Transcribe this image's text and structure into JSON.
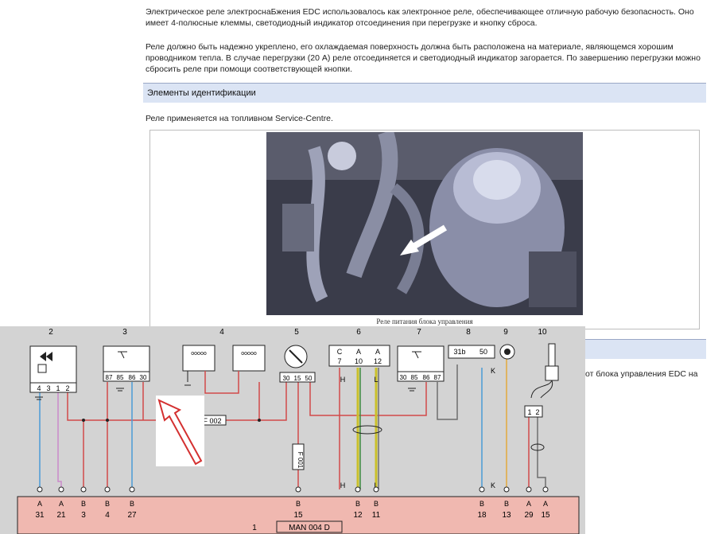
{
  "document": {
    "para1": "Электрическое реле электроснаБжения EDC использовалось как электронное реле, обеспечивающее отличную рабочую безопасность. Оно имеет 4-полюсные клеммы, светодиодный индикатор отсоединения при перегрузке и кнопку сброса.",
    "para2": "Реле должно быть надежно укреплено, его охлаждаемая поверхность должна быть расположена на материале, являющемся хорошим проводником тепла. В случае перегрузки (20 А) реле отсоединяется и светодиодный индикатор загорается. По завершению перегрузки можно сбросить реле при помощи соответствующей кнопки.",
    "section_title": "Элементы идентификации",
    "para3": "Реле применяется на топливном Service-Centre.",
    "photo_caption": "Реле питания блока управления",
    "para4_fragment": "от блока управления EDC на"
  },
  "diagram": {
    "component_numbers": [
      "2",
      "3",
      "4",
      "5",
      "6",
      "7",
      "8",
      "9",
      "10"
    ],
    "relay2_pins": [
      "4",
      "3",
      "1",
      "2"
    ],
    "relay3_pins": [
      "87",
      "85",
      "86",
      "30"
    ],
    "fuse5_pins": [
      "30",
      "15",
      "50"
    ],
    "conn6_top": [
      "C",
      "A",
      "A"
    ],
    "conn6_bottom": [
      "7",
      "10",
      "12"
    ],
    "relay7_pins": [
      "30",
      "85",
      "86",
      "87"
    ],
    "conn8_pins": [
      "31b",
      "50"
    ],
    "comp10_pins": [
      "1",
      "2"
    ],
    "wire_label_f002": "F 002",
    "fuse_label_f001": "F 001",
    "wire_h": "H",
    "wire_l": "L",
    "wire_k": "K",
    "ecu_number": "1",
    "ecu_label": "MAN 004 D",
    "ecu_pins": [
      {
        "letter": "A",
        "num": "31"
      },
      {
        "letter": "A",
        "num": "21"
      },
      {
        "letter": "B",
        "num": "3"
      },
      {
        "letter": "B",
        "num": "4"
      },
      {
        "letter": "B",
        "num": "27"
      },
      {
        "letter": "B",
        "num": "15"
      },
      {
        "letter": "B",
        "num": "12"
      },
      {
        "letter": "B",
        "num": "11"
      },
      {
        "letter": "B",
        "num": "18"
      },
      {
        "letter": "B",
        "num": "13"
      },
      {
        "letter": "A",
        "num": "29"
      },
      {
        "letter": "A",
        "num": "15"
      }
    ],
    "colors": {
      "red_wire": "#d24a4a",
      "blue_wire": "#4a9bd6",
      "pink_wire": "#c98ac9",
      "yellow_wire": "#c9c02a",
      "green_wire": "#3d8a3d",
      "gray_wire": "#6e6e6e",
      "orange_wire": "#e3a93c",
      "ecu_fill": "#f0b8b0"
    }
  }
}
